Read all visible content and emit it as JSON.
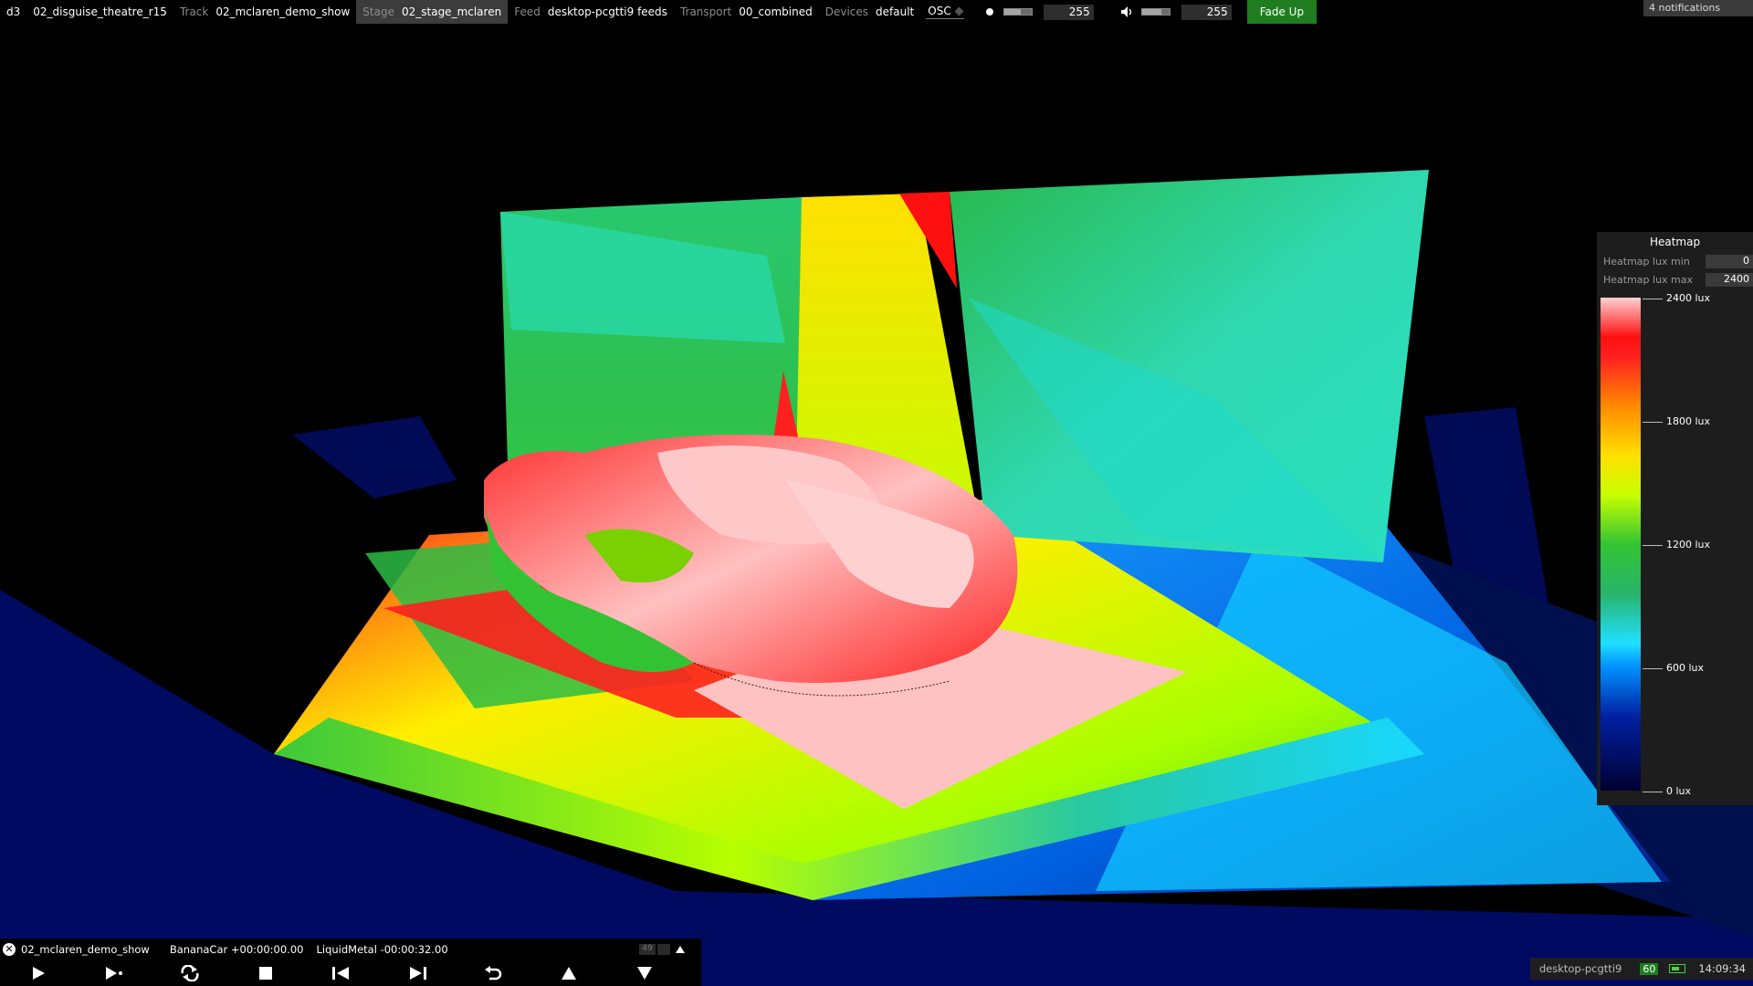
{
  "topbar": {
    "app": "d3",
    "project": "02_disguise_theatre_r15",
    "track_label": "Track",
    "track": "02_mclaren_demo_show",
    "stage_label": "Stage",
    "stage": "02_stage_mclaren",
    "feed_label": "Feed",
    "feed": "desktop-pcgtti9 feeds",
    "transport_label": "Transport",
    "transport": "00_combined",
    "devices_label": "Devices",
    "devices": "default",
    "osc": "OSC",
    "brightness_value": "255",
    "brightness_level": 0.6,
    "volume_value": "255",
    "volume_level": 0.7,
    "fade_button": "Fade Up",
    "notifications": "4 notifications"
  },
  "heatmap": {
    "title": "Heatmap",
    "min_label": "Heatmap lux min",
    "min_value": "0",
    "max_label": "Heatmap lux max",
    "max_value": "2400",
    "ticks": [
      "2400 lux",
      "1800 lux",
      "1200 lux",
      "600 lux",
      "0 lux"
    ]
  },
  "transport": {
    "track": "02_mclaren_demo_show",
    "layer1": "BananaCar +00:00:00.00",
    "layer2": "LiquidMetal -00:00:32.00",
    "mini_count": "49"
  },
  "status": {
    "host": "desktop-pcgtti9",
    "fps": "60",
    "time": "14:09:34"
  },
  "colors": {
    "accent_green": "#1f7d1f",
    "heat_high": "#ff1010",
    "heat_mid": "#ffe000",
    "heat_low": "#000030"
  }
}
